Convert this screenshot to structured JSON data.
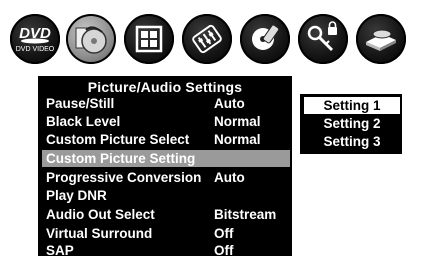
{
  "icons": [
    {
      "name": "dvd-video-icon",
      "label": "DVD VIDEO"
    },
    {
      "name": "disc-audio-icon"
    },
    {
      "name": "windows-icon"
    },
    {
      "name": "equalizer-sliders-icon"
    },
    {
      "name": "remote-disc-icon"
    },
    {
      "name": "key-lock-icon"
    },
    {
      "name": "tray-player-icon"
    }
  ],
  "menu": {
    "title": "Picture/Audio  Settings",
    "items": [
      {
        "label": "Pause/Still",
        "value": "Auto"
      },
      {
        "label": "Black Level",
        "value": "Normal"
      },
      {
        "label": "Custom Picture Select",
        "value": "Normal"
      },
      {
        "label": "Custom Picture Setting",
        "value": ""
      },
      {
        "label": "Progressive Conversion",
        "value": "Auto"
      },
      {
        "label": "Play DNR",
        "value": ""
      },
      {
        "label": "Audio Out Select",
        "value": "Bitstream"
      },
      {
        "label": "Virtual Surround",
        "value": "Off"
      },
      {
        "label": "SAP",
        "value": "Off"
      }
    ],
    "selected_index": 3
  },
  "submenu": {
    "items": [
      "Setting 1",
      "Setting 2",
      "Setting 3"
    ],
    "highlighted_index": 0
  },
  "colors": {
    "menu_bg": "#000000",
    "selected_row": "#9a9a9a",
    "text": "#ffffff"
  }
}
